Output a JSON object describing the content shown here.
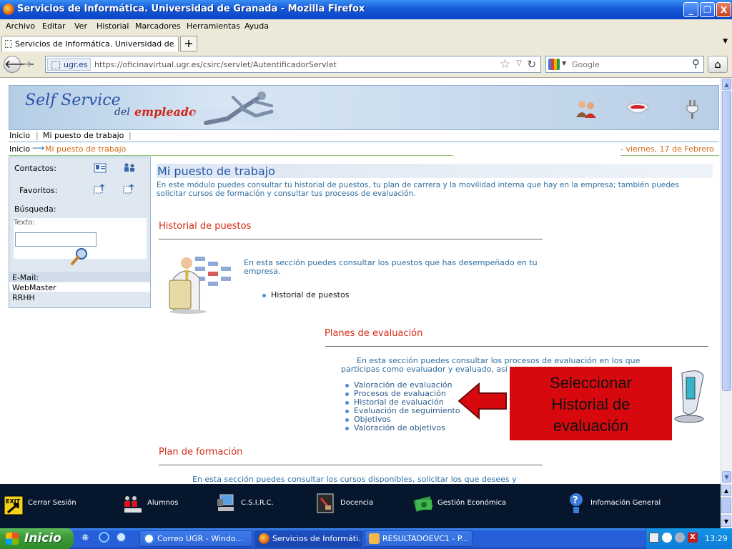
{
  "window": {
    "title": "Servicios de Informática. Universidad de Granada - Mozilla Firefox",
    "buttons": {
      "minimize": "_",
      "maximize": "❐",
      "close": "X"
    }
  },
  "menu": [
    "Archivo",
    "Editar",
    "Ver",
    "Historial",
    "Marcadores",
    "Herramientas",
    "Ayuda"
  ],
  "tab": {
    "label": "Servicios de Informática. Universidad de Gra...",
    "new_tab": "+"
  },
  "nav": {
    "site_badge": "ugr.es",
    "url": "https://oficinavirtual.ugr.es/csirc/servlet/AutentificadorServlet",
    "search_placeholder": "Google"
  },
  "banner": {
    "title_1": "Self Service",
    "title_2": "del",
    "title_3": "empleado"
  },
  "breadcrumb_top": [
    "Inicio",
    "Mi puesto de trabajo"
  ],
  "breadcrumb_path": {
    "home": "Inicio",
    "current": "Mi puesto de trabajo",
    "date": "- viernes, 17 de Febrero"
  },
  "sidebar": {
    "contacts_label": "Contactos:",
    "favorites_label": "Favoritos:",
    "search_label": "Búsqueda:",
    "text_label": "Texto:",
    "email_label": "E-Mail:",
    "emails": [
      "WebMaster",
      "RRHH"
    ]
  },
  "main": {
    "page_title": "Mi puesto de trabajo",
    "intro": "En este módulo puedes consultar tu historial de puestos, tu plan de carrera y la movilidad interna que hay en la empresa; también puedes solicitar cursos de formación y consultar tus procesos de evaluación.",
    "historial": {
      "heading": "Historial de puestos",
      "text": "En esta sección puedes consultar los puestos que has desempeñado en tu empresa.",
      "link": "Historial de puestos"
    },
    "planes": {
      "heading": "Planes de evaluación",
      "text": "En esta sección puedes consultar los procesos de evaluación en los que participas como evaluador y evaluado, así",
      "links": [
        "Valoración de evaluación",
        "Procesos de evaluación",
        "Historial de evaluación",
        "Evaluación de seguimiento",
        "Objetivos",
        "Valoración de objetivos"
      ]
    },
    "formacion": {
      "heading": "Plan de formación",
      "text": "En esta sección puedes consultar los cursos disponibles, solicitar los que desees y"
    }
  },
  "callout": {
    "line1": "Seleccionar",
    "line2": "Historial de",
    "line3": "evaluación"
  },
  "bottom_bar": [
    "Cerrar Sesión",
    "Alumnos",
    "C.S.I.R.C.",
    "Docencia",
    "Gestión Económica",
    "Infomación General"
  ],
  "taskbar": {
    "start": "Inicio",
    "items": [
      "Correo UGR - Windo...",
      "Servicios de Informáti...",
      "RESULTADOEVC1 - P..."
    ],
    "clock": "13:29"
  },
  "colors": {
    "accent_red": "#d52a17",
    "title_blue": "#2554a6",
    "callout_bg": "#d8090e"
  }
}
